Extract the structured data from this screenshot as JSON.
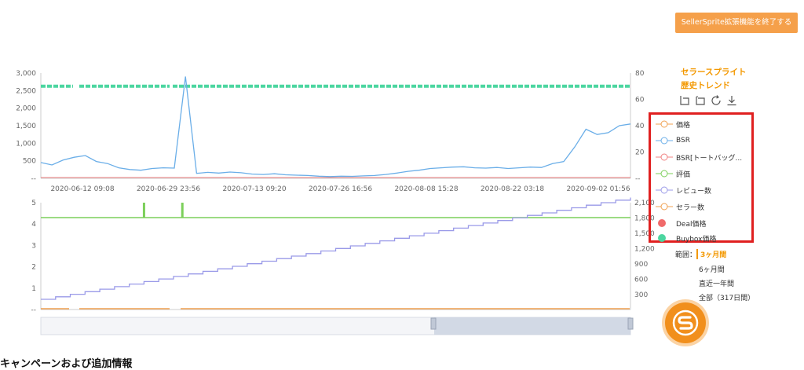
{
  "top_button": {
    "label": "SellerSprite拡張機能を終了する"
  },
  "side": {
    "title_line1": "セラースプライト",
    "title_line2": "歴史トレンド",
    "toolbox": [
      "zoom-icon",
      "zoom-reset-icon",
      "refresh-icon",
      "download-icon"
    ]
  },
  "legend": {
    "items": [
      {
        "label": "価格",
        "color": "#f0a050",
        "shape": "line-circle"
      },
      {
        "label": "BSR",
        "color": "#6aaee8",
        "shape": "line-circle"
      },
      {
        "label": "BSR[トートバッグ...",
        "color": "#f08080",
        "shape": "line-circle"
      },
      {
        "label": "評価",
        "color": "#7ccf5a",
        "shape": "line-circle"
      },
      {
        "label": "レビュー数",
        "color": "#9a9ae8",
        "shape": "line-circle"
      },
      {
        "label": "セラー数",
        "color": "#f0a050",
        "shape": "line-circle"
      },
      {
        "label": "Deal価格",
        "color": "#f06a6a",
        "shape": "dot"
      },
      {
        "label": "Buybox価格",
        "color": "#4cd6a0",
        "shape": "dot"
      }
    ]
  },
  "range": {
    "label": "範囲：",
    "selected": "3ヶ月間",
    "options": [
      "6ヶ月間",
      "直近一年間",
      "全部（317日間）"
    ]
  },
  "section_title": "キャンペーンおよび追加情報",
  "chart_data": [
    {
      "type": "line",
      "x": [
        "2020-06-12 09:08",
        "2020-06-29 23:56",
        "2020-07-13 09:20",
        "2020-07-26 16:56",
        "2020-08-08 15:28",
        "2020-08-22 03:18",
        "2020-09-02 01:56"
      ],
      "y_left_ticks": [
        "--",
        "500",
        "1,000",
        "1,500",
        "2,000",
        "2,500",
        "3,000"
      ],
      "y_right_ticks": [
        "--",
        "20",
        "40",
        "60",
        "80"
      ],
      "ylim_left": [
        0,
        3000
      ],
      "ylim_right": [
        0,
        80
      ],
      "series": [
        {
          "name": "BSR",
          "color": "#6aaee8",
          "values": [
            450,
            380,
            520,
            600,
            650,
            480,
            420,
            300,
            250,
            230,
            280,
            300,
            290,
            2900,
            140,
            170,
            150,
            180,
            160,
            120,
            110,
            130,
            100,
            90,
            80,
            60,
            50,
            60,
            55,
            70,
            80,
            110,
            150,
            200,
            230,
            280,
            300,
            320,
            330,
            300,
            290,
            310,
            280,
            300,
            320,
            310,
            420,
            480,
            900,
            1400,
            1250,
            1300,
            1500,
            1550
          ]
        },
        {
          "name": "Buybox価格",
          "color": "#4cd6a0",
          "values_right": 70
        },
        {
          "name": "BSR[トートバッグ...",
          "color": "#f08080",
          "values_right": 0
        }
      ]
    },
    {
      "type": "line",
      "y_left_ticks": [
        "--",
        "1",
        "2",
        "3",
        "4",
        "5"
      ],
      "y_right_ticks": [
        "300",
        "600",
        "900",
        "1,200",
        "1,500",
        "1,800",
        "2,100"
      ],
      "ylim_left": [
        0,
        5
      ],
      "ylim_right": [
        0,
        2100
      ],
      "series": [
        {
          "name": "評価",
          "color": "#7ccf5a",
          "value": 4.3,
          "spikes": [
            {
              "x": 0.175,
              "y": 5
            },
            {
              "x": 0.24,
              "y": 5
            }
          ]
        },
        {
          "name": "レビュー数",
          "color": "#9a9ae8",
          "start": 200,
          "end": 2200
        },
        {
          "name": "セラー数",
          "color": "#f0a050",
          "value": 0
        }
      ]
    }
  ]
}
